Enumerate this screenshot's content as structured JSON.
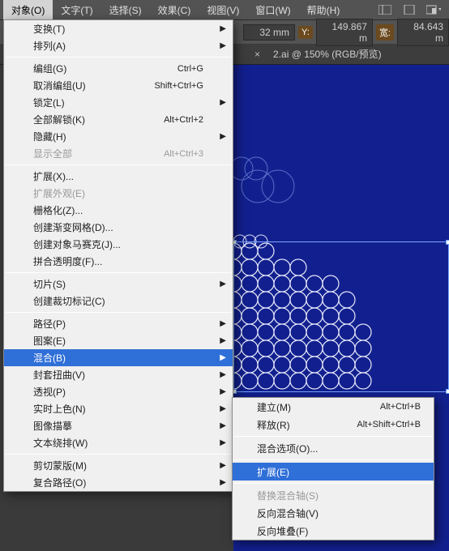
{
  "menubar": {
    "items": [
      {
        "label": "对象(O)"
      },
      {
        "label": "文字(T)"
      },
      {
        "label": "选择(S)"
      },
      {
        "label": "效果(C)"
      },
      {
        "label": "视图(V)"
      },
      {
        "label": "窗口(W)"
      },
      {
        "label": "帮助(H)"
      }
    ]
  },
  "toolbar": {
    "x_unit": "32 mm",
    "y_label": "Y:",
    "y_value": "149.867 m",
    "w_label": "宽:",
    "w_value": "84.643 m"
  },
  "tabbar": {
    "close_icon": "×",
    "doc": "2.ai @ 150% (RGB/预览)"
  },
  "menu": {
    "items": [
      {
        "label": "变换(T)",
        "sub": true
      },
      {
        "label": "排列(A)",
        "sub": true
      },
      {
        "sep": true
      },
      {
        "label": "编组(G)",
        "shortcut": "Ctrl+G"
      },
      {
        "label": "取消编组(U)",
        "shortcut": "Shift+Ctrl+G"
      },
      {
        "label": "锁定(L)",
        "sub": true
      },
      {
        "label": "全部解锁(K)",
        "shortcut": "Alt+Ctrl+2"
      },
      {
        "label": "隐藏(H)",
        "sub": true
      },
      {
        "label": "显示全部",
        "shortcut": "Alt+Ctrl+3",
        "dis": true
      },
      {
        "sep": true
      },
      {
        "label": "扩展(X)..."
      },
      {
        "label": "扩展外观(E)",
        "dis": true
      },
      {
        "label": "栅格化(Z)..."
      },
      {
        "label": "创建渐变网格(D)..."
      },
      {
        "label": "创建对象马赛克(J)..."
      },
      {
        "label": "拼合透明度(F)..."
      },
      {
        "sep": true
      },
      {
        "label": "切片(S)",
        "sub": true
      },
      {
        "label": "创建裁切标记(C)"
      },
      {
        "sep": true
      },
      {
        "label": "路径(P)",
        "sub": true
      },
      {
        "label": "图案(E)",
        "sub": true
      },
      {
        "label": "混合(B)",
        "sub": true,
        "hov": true
      },
      {
        "label": "封套扭曲(V)",
        "sub": true
      },
      {
        "label": "透视(P)",
        "sub": true
      },
      {
        "label": "实时上色(N)",
        "sub": true
      },
      {
        "label": "图像描摹",
        "sub": true
      },
      {
        "label": "文本绕排(W)",
        "sub": true
      },
      {
        "sep": true
      },
      {
        "label": "剪切蒙版(M)",
        "sub": true
      },
      {
        "label": "复合路径(O)",
        "sub": true
      }
    ]
  },
  "submenu": {
    "items": [
      {
        "label": "建立(M)",
        "shortcut": "Alt+Ctrl+B"
      },
      {
        "label": "释放(R)",
        "shortcut": "Alt+Shift+Ctrl+B"
      },
      {
        "sep": true
      },
      {
        "label": "混合选项(O)..."
      },
      {
        "sep": true
      },
      {
        "label": "扩展(E)",
        "hov": true
      },
      {
        "sep": true
      },
      {
        "label": "替换混合轴(S)",
        "dis": true
      },
      {
        "label": "反向混合轴(V)"
      },
      {
        "label": "反向堆叠(F)"
      }
    ]
  }
}
